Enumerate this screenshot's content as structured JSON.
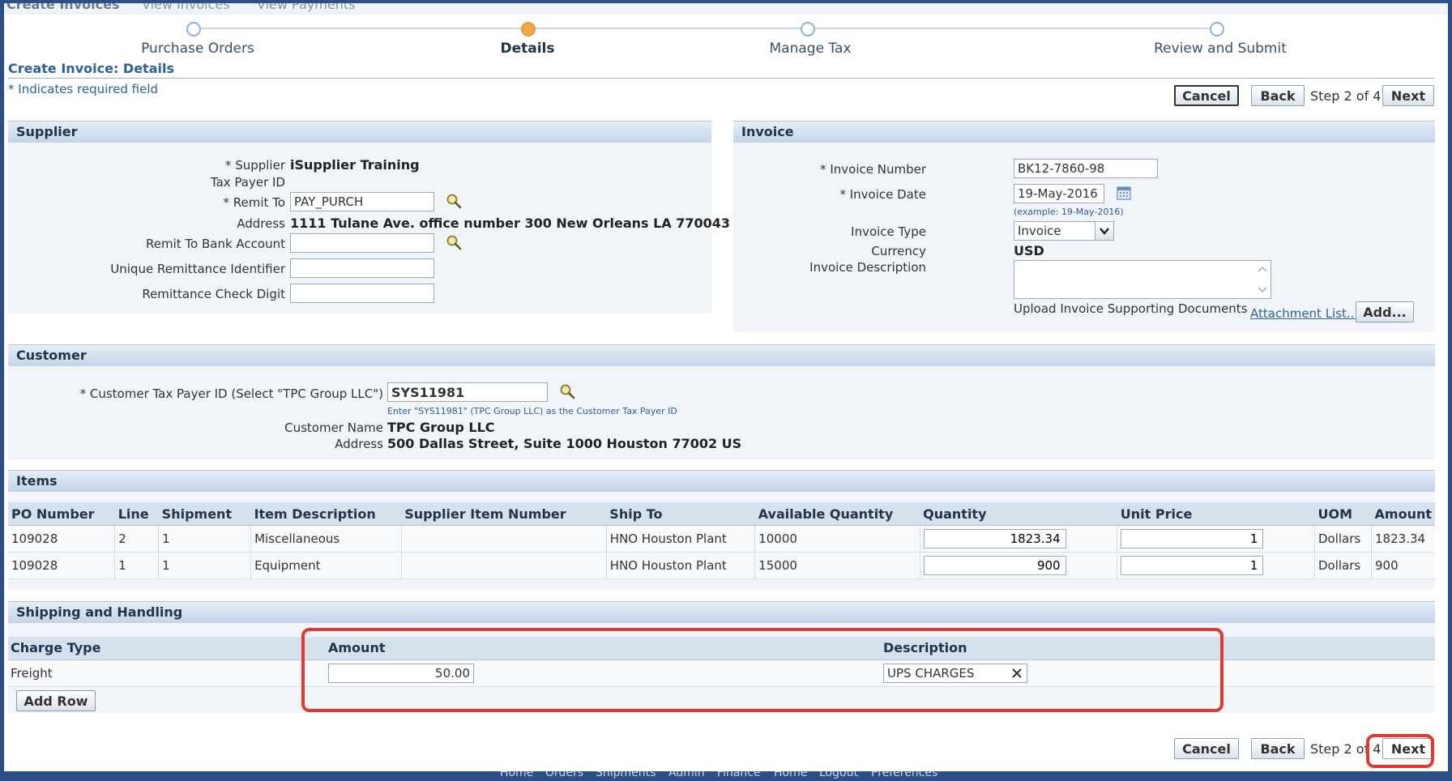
{
  "top_tabs": [
    "Create Invoices",
    "View Invoices",
    "View Payments"
  ],
  "train": {
    "steps": [
      {
        "label": "Purchase Orders",
        "active": false
      },
      {
        "label": "Details",
        "active": true
      },
      {
        "label": "Manage Tax",
        "active": false
      },
      {
        "label": "Review and Submit",
        "active": false
      }
    ]
  },
  "page": {
    "title": "Create Invoice: Details",
    "required_note": "* Indicates required field",
    "cancel_label": "Cancel",
    "back_label": "Back",
    "step_text": "Step 2 of 4",
    "next_label": "Next"
  },
  "supplier": {
    "header": "Supplier",
    "supplier_label": "* Supplier",
    "supplier_value": "iSupplier Training",
    "taxpayer_label": "Tax Payer ID",
    "remit_to_label": "* Remit To",
    "remit_to_value": "PAY_PURCH",
    "address_label": "Address",
    "address_value": "1111 Tulane Ave. office number 300 New Orleans LA 770043",
    "bank_label": "Remit To Bank Account",
    "bank_value": "",
    "uri_label": "Unique Remittance Identifier",
    "uri_value": "",
    "check_label": "Remittance Check Digit",
    "check_value": ""
  },
  "invoice": {
    "header": "Invoice",
    "number_label": "* Invoice Number",
    "number_value": "BK12-7860-98",
    "date_label": "* Invoice Date",
    "date_value": "19-May-2016",
    "date_hint": "(example: 19-May-2016)",
    "type_label": "Invoice Type",
    "type_value": "Invoice",
    "currency_label": "Currency",
    "currency_value": "USD",
    "desc_label": "Invoice Description",
    "desc_value": "",
    "upload_label": "Upload Invoice Supporting Documents",
    "attachment_link": "Attachment List...",
    "add_label": "Add..."
  },
  "customer": {
    "header": "Customer",
    "taxpayer_label": "* Customer Tax Payer ID (Select \"TPC Group LLC\")",
    "taxpayer_value": "SYS11981",
    "hint": "Enter \"SYS11981\" (TPC Group LLC) as the Customer Tax Payer ID",
    "name_label": "Customer Name",
    "name_value": "TPC Group LLC",
    "address_label": "Address",
    "address_value": "500 Dallas Street, Suite 1000 Houston 77002 US"
  },
  "items": {
    "header": "Items",
    "columns": [
      "PO Number",
      "Line",
      "Shipment",
      "Item Description",
      "Supplier Item Number",
      "Ship To",
      "Available Quantity",
      "Quantity",
      "Unit Price",
      "UOM",
      "Amount"
    ],
    "rows": [
      {
        "po": "109028",
        "line": "2",
        "shipment": "1",
        "desc": "Miscellaneous",
        "sup_item": "",
        "ship_to": "HNO Houston Plant",
        "avail": "10000",
        "qty": "1823.34",
        "price": "1",
        "uom": "Dollars",
        "amount": "1823.34"
      },
      {
        "po": "109028",
        "line": "1",
        "shipment": "1",
        "desc": "Equipment",
        "sup_item": "",
        "ship_to": "HNO Houston Plant",
        "avail": "15000",
        "qty": "900",
        "price": "1",
        "uom": "Dollars",
        "amount": "900"
      }
    ]
  },
  "shipping": {
    "header": "Shipping and Handling",
    "col_charge": "Charge Type",
    "col_amount": "Amount",
    "col_desc": "Description",
    "charge_type": "Freight",
    "amount_value": "50.00",
    "desc_value": "UPS CHARGES",
    "add_row_label": "Add Row"
  },
  "footer_links": [
    "Home",
    "Orders",
    "Shipments",
    "Admin",
    "Finance",
    "Home",
    "Logout",
    "Preferences"
  ],
  "colors": {
    "accent": "#2c4f86",
    "highlight": "#e03a2f",
    "active_step": "#f5a742"
  }
}
